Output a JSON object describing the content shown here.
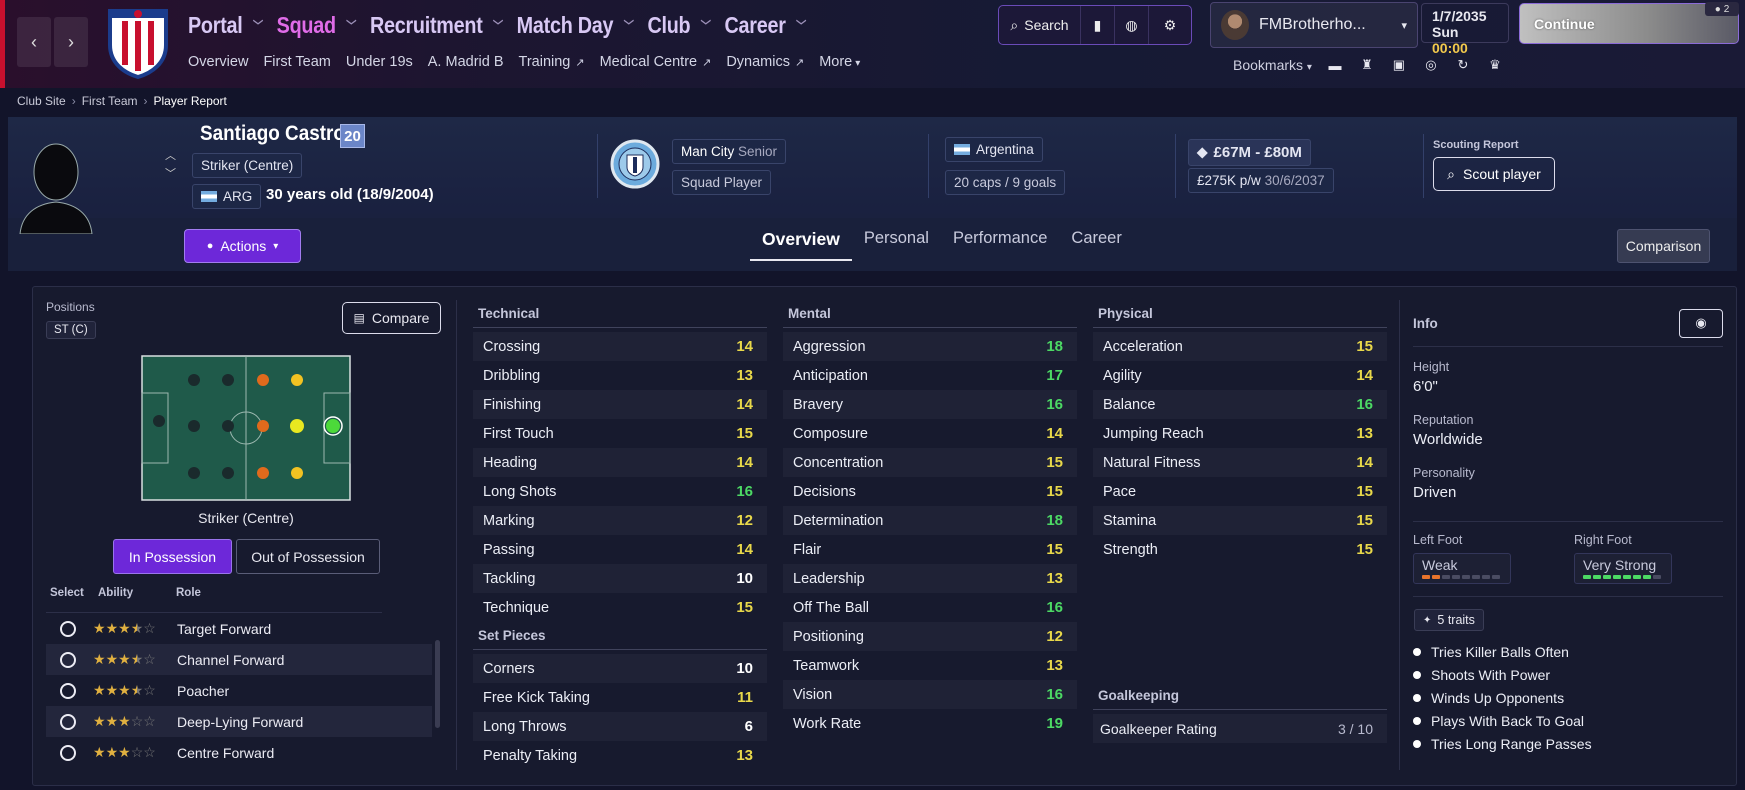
{
  "nav": {
    "main": [
      "Portal",
      "Squad",
      "Recruitment",
      "Match Day",
      "Club",
      "Career"
    ],
    "active": "Squad",
    "sub": [
      "Overview",
      "First Team",
      "Under 19s",
      "A. Madrid B",
      "Training",
      "Medical Centre",
      "Dynamics",
      "More"
    ],
    "search_label": "Search",
    "user": "FMBrotherho...",
    "date": "1/7/2035",
    "day": "Sun",
    "time": "00:00",
    "continue_label": "Continue",
    "notif_count": "2",
    "bookmarks_label": "Bookmarks"
  },
  "breadcrumb": [
    "Club Site",
    "First Team",
    "Player Report"
  ],
  "player": {
    "name": "Santiago Castro",
    "age_badge": "20",
    "position": "Striker (Centre)",
    "nationality_code": "ARG",
    "age_text": "30 years old (18/9/2004)",
    "club": "Man City",
    "club_level": "Senior",
    "squad_status": "Squad Player",
    "nation": "Argentina",
    "caps": "20 caps / 9 goals",
    "value": "£67M - £80M",
    "wage": "£275K p/w",
    "contract": "30/6/2037",
    "scouting_label": "Scouting Report",
    "scout_button": "Scout player"
  },
  "header": {
    "actions_label": "Actions",
    "tabs": [
      "Overview",
      "Personal",
      "Performance",
      "Career"
    ],
    "active_tab": "Overview",
    "comparison_label": "Comparison"
  },
  "positions": {
    "title": "Positions",
    "tag": "ST (C)",
    "compare_label": "Compare",
    "pitch_caption": "Striker (Centre)",
    "in_possession": "In Possession",
    "out_possession": "Out of Possession",
    "headers": [
      "Select",
      "Ability",
      "Role"
    ],
    "roles": [
      {
        "name": "Target Forward",
        "stars": 3.5
      },
      {
        "name": "Channel Forward",
        "stars": 3.5
      },
      {
        "name": "Poacher",
        "stars": 3.5
      },
      {
        "name": "Deep-Lying Forward",
        "stars": 3
      },
      {
        "name": "Centre Forward",
        "stars": 3
      }
    ]
  },
  "attributes": {
    "technical_title": "Technical",
    "technical": [
      {
        "name": "Crossing",
        "value": 14
      },
      {
        "name": "Dribbling",
        "value": 13
      },
      {
        "name": "Finishing",
        "value": 14
      },
      {
        "name": "First Touch",
        "value": 15
      },
      {
        "name": "Heading",
        "value": 14
      },
      {
        "name": "Long Shots",
        "value": 16
      },
      {
        "name": "Marking",
        "value": 12
      },
      {
        "name": "Passing",
        "value": 14
      },
      {
        "name": "Tackling",
        "value": 10
      },
      {
        "name": "Technique",
        "value": 15
      }
    ],
    "setpieces_title": "Set Pieces",
    "setpieces": [
      {
        "name": "Corners",
        "value": 10
      },
      {
        "name": "Free Kick Taking",
        "value": 11
      },
      {
        "name": "Long Throws",
        "value": 6
      },
      {
        "name": "Penalty Taking",
        "value": 13
      }
    ],
    "mental_title": "Mental",
    "mental": [
      {
        "name": "Aggression",
        "value": 18
      },
      {
        "name": "Anticipation",
        "value": 17
      },
      {
        "name": "Bravery",
        "value": 16
      },
      {
        "name": "Composure",
        "value": 14
      },
      {
        "name": "Concentration",
        "value": 15
      },
      {
        "name": "Decisions",
        "value": 15
      },
      {
        "name": "Determination",
        "value": 18
      },
      {
        "name": "Flair",
        "value": 15
      },
      {
        "name": "Leadership",
        "value": 13
      },
      {
        "name": "Off The Ball",
        "value": 16
      },
      {
        "name": "Positioning",
        "value": 12
      },
      {
        "name": "Teamwork",
        "value": 13
      },
      {
        "name": "Vision",
        "value": 16
      },
      {
        "name": "Work Rate",
        "value": 19
      }
    ],
    "physical_title": "Physical",
    "physical": [
      {
        "name": "Acceleration",
        "value": 15
      },
      {
        "name": "Agility",
        "value": 14
      },
      {
        "name": "Balance",
        "value": 16
      },
      {
        "name": "Jumping Reach",
        "value": 13
      },
      {
        "name": "Natural Fitness",
        "value": 14
      },
      {
        "name": "Pace",
        "value": 15
      },
      {
        "name": "Stamina",
        "value": 15
      },
      {
        "name": "Strength",
        "value": 15
      }
    ],
    "gk_title": "Goalkeeping",
    "gk_label": "Goalkeeper Rating",
    "gk_value": "3 / 10"
  },
  "info": {
    "title": "Info",
    "height_label": "Height",
    "height": "6'0\"",
    "reputation_label": "Reputation",
    "reputation": "Worldwide",
    "personality_label": "Personality",
    "personality": "Driven",
    "left_foot_label": "Left Foot",
    "left_foot": "Weak",
    "left_foot_level": 2,
    "right_foot_label": "Right Foot",
    "right_foot": "Very Strong",
    "right_foot_level": 7,
    "traits_label": "5 traits",
    "traits": [
      "Tries Killer Balls Often",
      "Shoots With Power",
      "Winds Up Opponents",
      "Plays With Back To Goal",
      "Tries Long Range Passes"
    ]
  },
  "colors": {
    "accent": "#6d28d9",
    "attr_good": "#4cd964",
    "attr_mid": "#e8d84a",
    "attr_low": "#ffffff",
    "squad_active": "#e06ce8"
  }
}
